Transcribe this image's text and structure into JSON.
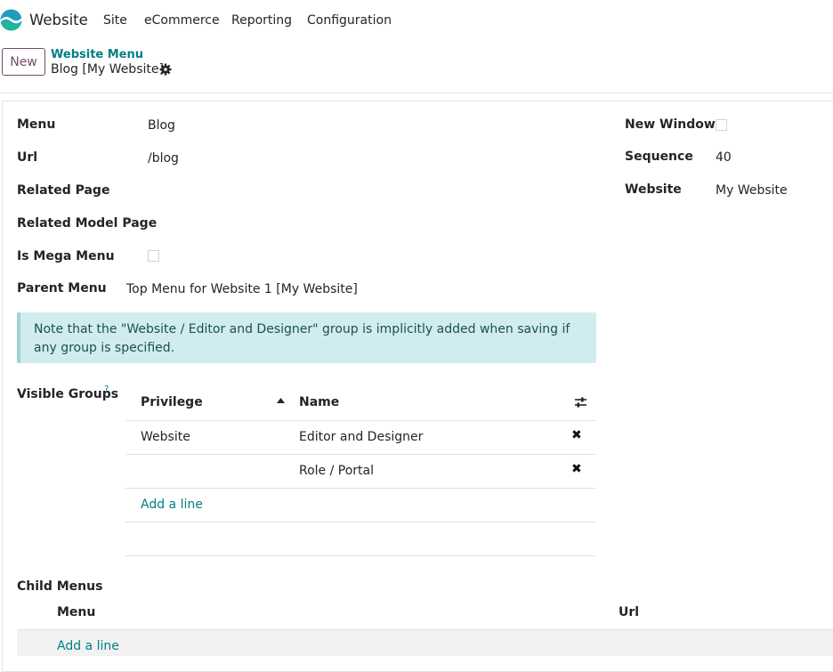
{
  "app": {
    "name": "Website",
    "menu": [
      "Site",
      "eCommerce",
      "Reporting",
      "Configuration"
    ]
  },
  "control": {
    "new_label": "New",
    "breadcrumb_parent": "Website Menu",
    "breadcrumb_current": "Blog [My Website]"
  },
  "form": {
    "menu_label": "Menu",
    "menu_value": "Blog",
    "url_label": "Url",
    "url_value": "/blog",
    "related_page_label": "Related Page",
    "related_model_page_label": "Related Model Page",
    "is_mega_menu_label": "Is Mega Menu",
    "parent_menu_label": "Parent Menu",
    "parent_menu_value": "Top Menu for Website 1 [My Website]",
    "new_window_label": "New Window",
    "sequence_label": "Sequence",
    "sequence_value": "40",
    "website_label": "Website",
    "website_value": "My Website"
  },
  "alert": {
    "text": "Note that the \"Website / Editor and Designer\" group is implicitly added when saving if any group is specified."
  },
  "groups": {
    "label": "Visible Groups",
    "help": "?",
    "columns": [
      "Privilege",
      "Name"
    ],
    "rows": [
      {
        "privilege": "Website",
        "name": "Editor and Designer"
      },
      {
        "privilege": "",
        "name": "Role / Portal"
      }
    ],
    "add_line": "Add a line"
  },
  "child_menus": {
    "label": "Child Menus",
    "columns": [
      "Menu",
      "Url"
    ],
    "add_line": "Add a line"
  },
  "colors": {
    "accent": "#017E84",
    "primary": "#714B67",
    "alert_bg": "#d1ecef"
  },
  "icons": [
    "website-logo-icon",
    "gear-icon",
    "sort-asc-icon",
    "column-settings-icon",
    "delete-icon"
  ]
}
